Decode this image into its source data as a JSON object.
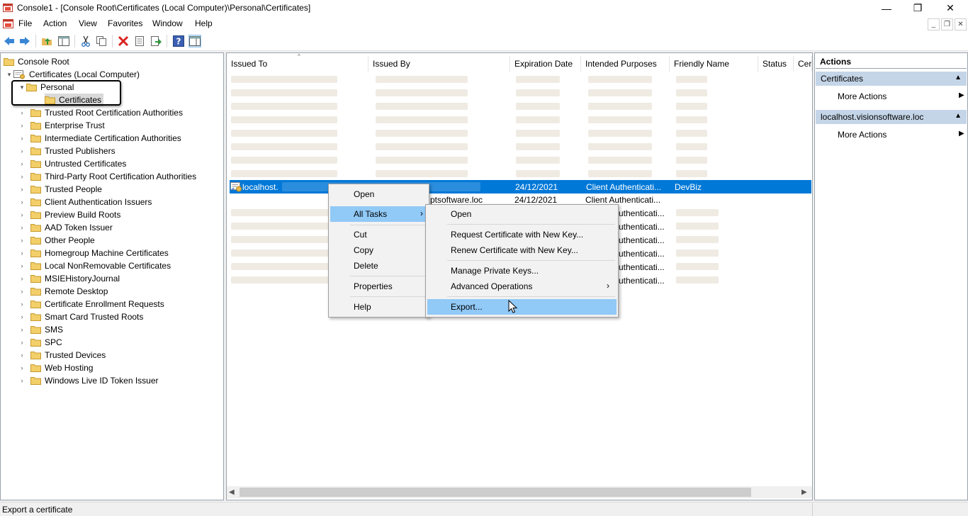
{
  "window": {
    "title": "Console1 - [Console Root\\Certificates (Local Computer)\\Personal\\Certificates]",
    "controls": {
      "minimize": "—",
      "restore": "❐",
      "close": "✕"
    }
  },
  "menubar": {
    "items": [
      "File",
      "Action",
      "View",
      "Favorites",
      "Window",
      "Help"
    ]
  },
  "toolbar": {
    "icons": [
      "back-icon",
      "forward-icon",
      "up-folder-icon",
      "show-hide-tree-icon",
      "cut-icon",
      "copy-icon",
      "delete-icon",
      "properties-icon",
      "export-list-icon",
      "help-icon",
      "show-hide-action-pane-icon"
    ]
  },
  "tree": {
    "root": "Console Root",
    "computer": "Certificates (Local Computer)",
    "personal": "Personal",
    "personal_child": "Certificates",
    "stores": [
      "Trusted Root Certification Authorities",
      "Enterprise Trust",
      "Intermediate Certification Authorities",
      "Trusted Publishers",
      "Untrusted Certificates",
      "Third-Party Root Certification Authorities",
      "Trusted People",
      "Client Authentication Issuers",
      "Preview Build Roots",
      "AAD Token Issuer",
      "Other People",
      "Homegroup Machine Certificates",
      "Local NonRemovable Certificates",
      "MSIEHistoryJournal",
      "Remote Desktop",
      "Certificate Enrollment Requests",
      "Smart Card Trusted Roots",
      "SMS",
      "SPC",
      "Trusted Devices",
      "Web Hosting",
      "Windows Live ID Token Issuer"
    ]
  },
  "list": {
    "columns": [
      "Issued To",
      "Issued By",
      "Expiration Date",
      "Intended Purposes",
      "Friendly Name",
      "Status",
      "Cer"
    ],
    "selected_row": {
      "issued_to": "localhost.",
      "expiration": "24/12/2021",
      "purposes": "Client Authenticati...",
      "friendly_name": "DevBiz"
    },
    "partial_cells": {
      "row10_expiration": "24/12/2021",
      "row10_purposes": "Client Authenticati...",
      "row10_issuedby_tail": "ptsoftware.loc",
      "purposes_fragment": "uthenticati..."
    }
  },
  "actions": {
    "title": "Actions",
    "sections": [
      {
        "header": "Certificates",
        "item": "More Actions"
      },
      {
        "header": "localhost.visionsoftware.loc",
        "item": "More Actions"
      }
    ]
  },
  "context_menu": {
    "items": [
      "Open",
      "All Tasks",
      "Cut",
      "Copy",
      "Delete",
      "Properties",
      "Help"
    ]
  },
  "submenu": {
    "items": [
      "Open",
      "Request Certificate with New Key...",
      "Renew Certificate with New Key...",
      "Manage Private Keys...",
      "Advanced Operations",
      "Export..."
    ]
  },
  "statusbar": {
    "text": "Export a certificate"
  },
  "colors": {
    "selection": "#0078d7",
    "action_header": "#c4d5e8",
    "menu_highlight": "#91c9f7"
  }
}
